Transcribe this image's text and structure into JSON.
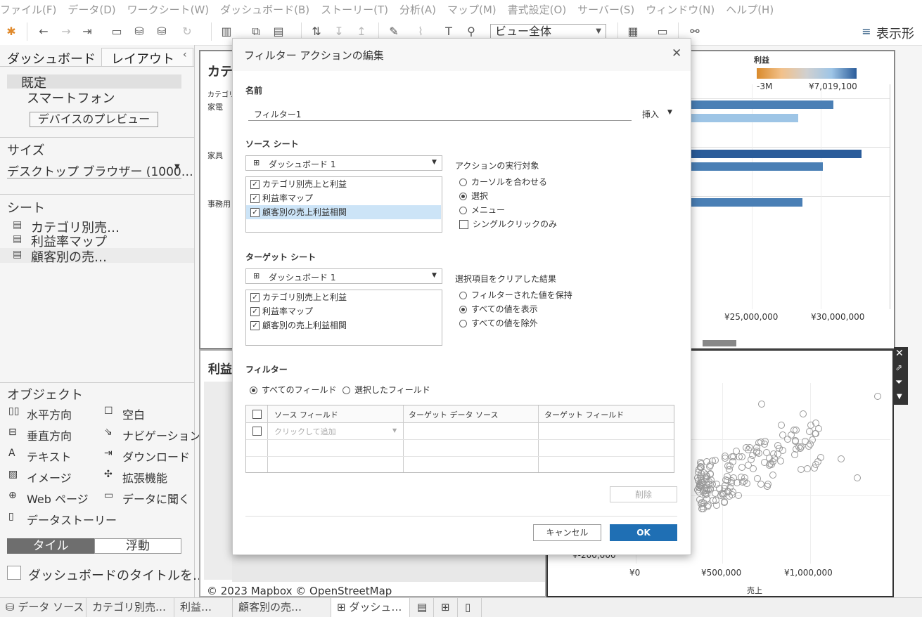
{
  "menu": [
    "ファイル(F)",
    "データ(D)",
    "ワークシート(W)",
    "ダッシュボード(B)",
    "ストーリー(T)",
    "分析(A)",
    "マップ(M)",
    "書式設定(O)",
    "サーバー(S)",
    "ウィンドウ(N)",
    "ヘルプ(H)"
  ],
  "toolbar": {
    "view_select": "ビュー全体",
    "show_me": "表示形"
  },
  "left": {
    "tab_dashboard": "ダッシュボード",
    "tab_layout": "レイアウト",
    "device_default": "既定",
    "device_phone": "スマートフォン",
    "device_preview_button": "デバイスのプレビュー",
    "size_header": "サイズ",
    "size_value": "デスクトップ ブラウザー (1000…",
    "sheets_header": "シート",
    "sheets": [
      "カテゴリ別売…",
      "利益率マップ",
      "顧客別の売…"
    ],
    "objects_header": "オブジェクト",
    "objects": [
      {
        "label": "水平方向",
        "icon": "horizontal-container-icon"
      },
      {
        "label": "空白",
        "icon": "blank-icon"
      },
      {
        "label": "垂直方向",
        "icon": "vertical-container-icon"
      },
      {
        "label": "ナビゲーション",
        "icon": "navigation-icon"
      },
      {
        "label": "テキスト",
        "icon": "text-icon"
      },
      {
        "label": "ダウンロード",
        "icon": "download-icon"
      },
      {
        "label": "イメージ",
        "icon": "image-icon"
      },
      {
        "label": "拡張機能",
        "icon": "extension-icon"
      },
      {
        "label": "Web ページ",
        "icon": "web-page-icon"
      },
      {
        "label": "データに聞く",
        "icon": "ask-data-icon"
      },
      {
        "label": "データストーリー",
        "icon": "data-story-icon"
      }
    ],
    "tile": "タイル",
    "float": "浮動",
    "show_title": "ダッシュボードのタイトルを…"
  },
  "dashboard": {
    "top_title": "カテゴ",
    "top_sub": "カテゴリ",
    "categories": [
      "家電",
      "家具",
      "事務用"
    ],
    "legend_title": "利益",
    "legend_min": "-3M",
    "legend_max": "¥7,019,100",
    "axis_ticks": [
      "¥25,000,000",
      "¥30,000,000"
    ],
    "map_title": "利益",
    "map_credit": "© 2023 Mapbox © OpenStreetMap",
    "scatter_y_tick": "¥-200,000",
    "scatter_x_ticks": [
      "¥0",
      "¥500,000",
      "¥1,000,000"
    ],
    "scatter_x_label": "売上"
  },
  "dialog": {
    "title": "フィルター アクションの編集",
    "name_label": "名前",
    "name_value": "フィルター1",
    "insert": "挿入",
    "source_label": "ソース シート",
    "source_select": "ダッシュボード 1",
    "source_sheets": [
      "カテゴリ別売上と利益",
      "利益率マップ",
      "顧客別の売上利益相関"
    ],
    "run_on_label": "アクションの実行対象",
    "run_on": [
      "カーソルを合わせる",
      "選択",
      "メニュー"
    ],
    "single_click": "シングルクリックのみ",
    "target_label": "ターゲット シート",
    "target_select": "ダッシュボード 1",
    "target_sheets": [
      "カテゴリ別売上と利益",
      "利益率マップ",
      "顧客別の売上利益相関"
    ],
    "clear_label": "選択項目をクリアした結果",
    "clear_options": [
      "フィルターされた値を保持",
      "すべての値を表示",
      "すべての値を除外"
    ],
    "filter_label": "フィルター",
    "all_fields": "すべてのフィールド",
    "selected_fields": "選択したフィールド",
    "col_source_field": "ソース フィールド",
    "col_target_ds": "ターゲット データ ソース",
    "col_target_field": "ターゲット フィールド",
    "click_to_add": "クリックして追加",
    "delete": "削除",
    "cancel": "キャンセル",
    "ok": "OK"
  },
  "tabs": [
    "データ ソース",
    "カテゴリ別売…",
    "利益…",
    "顧客別の売…",
    "ダッシュ…"
  ],
  "colors": {
    "accent": "#1f6fb4",
    "selected_row": "#cce4f7",
    "bar_dark": "#2a5c9a",
    "bar_mid": "#4a7fb5",
    "bar_light": "#9ec5e6"
  }
}
